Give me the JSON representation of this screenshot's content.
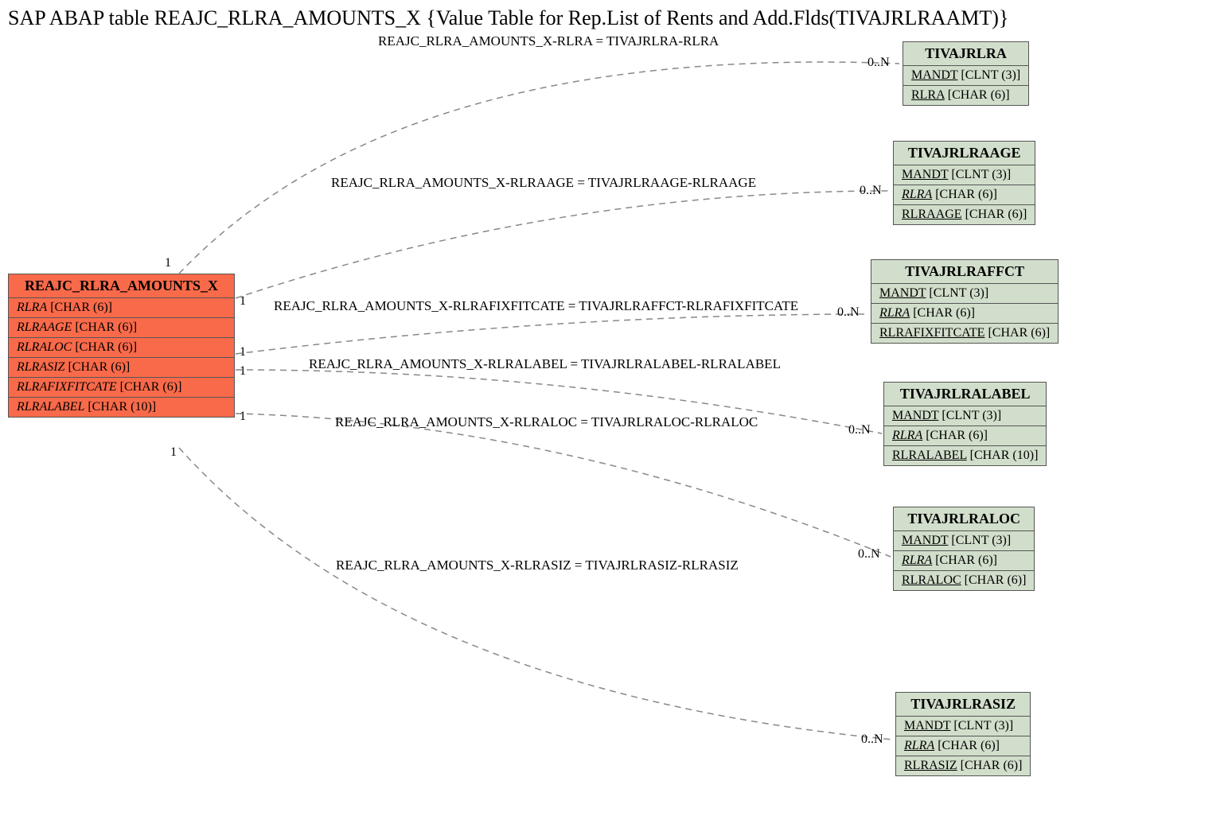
{
  "title": "SAP ABAP table REAJC_RLRA_AMOUNTS_X {Value Table for Rep.List of Rents and Add.Flds(TIVAJRLRAAMT)}",
  "source": {
    "name": "REAJC_RLRA_AMOUNTS_X",
    "fields": [
      {
        "name": "RLRA",
        "type": "[CHAR (6)]"
      },
      {
        "name": "RLRAAGE",
        "type": "[CHAR (6)]"
      },
      {
        "name": "RLRALOC",
        "type": "[CHAR (6)]"
      },
      {
        "name": "RLRASIZ",
        "type": "[CHAR (6)]"
      },
      {
        "name": "RLRAFIXFITCATE",
        "type": "[CHAR (6)]"
      },
      {
        "name": "RLRALABEL",
        "type": "[CHAR (10)]"
      }
    ]
  },
  "targets": [
    {
      "name": "TIVAJRLRA",
      "fields": [
        {
          "name": "MANDT",
          "type": "[CLNT (3)]",
          "underline": true
        },
        {
          "name": "RLRA",
          "type": "[CHAR (6)]",
          "underline": true
        }
      ]
    },
    {
      "name": "TIVAJRLRAAGE",
      "fields": [
        {
          "name": "MANDT",
          "type": "[CLNT (3)]",
          "underline": true
        },
        {
          "name": "RLRA",
          "type": "[CHAR (6)]",
          "underline": true,
          "italic": true
        },
        {
          "name": "RLRAAGE",
          "type": "[CHAR (6)]",
          "underline": true
        }
      ]
    },
    {
      "name": "TIVAJRLRAFFCT",
      "fields": [
        {
          "name": "MANDT",
          "type": "[CLNT (3)]",
          "underline": true
        },
        {
          "name": "RLRA",
          "type": "[CHAR (6)]",
          "underline": true,
          "italic": true
        },
        {
          "name": "RLRAFIXFITCATE",
          "type": "[CHAR (6)]",
          "underline": true
        }
      ]
    },
    {
      "name": "TIVAJRLRALABEL",
      "fields": [
        {
          "name": "MANDT",
          "type": "[CLNT (3)]",
          "underline": true
        },
        {
          "name": "RLRA",
          "type": "[CHAR (6)]",
          "underline": true,
          "italic": true
        },
        {
          "name": "RLRALABEL",
          "type": "[CHAR (10)]",
          "underline": true
        }
      ]
    },
    {
      "name": "TIVAJRLRALOC",
      "fields": [
        {
          "name": "MANDT",
          "type": "[CLNT (3)]",
          "underline": true
        },
        {
          "name": "RLRA",
          "type": "[CHAR (6)]",
          "underline": true,
          "italic": true
        },
        {
          "name": "RLRALOC",
          "type": "[CHAR (6)]",
          "underline": true
        }
      ]
    },
    {
      "name": "TIVAJRLRASIZ",
      "fields": [
        {
          "name": "MANDT",
          "type": "[CLNT (3)]",
          "underline": true
        },
        {
          "name": "RLRA",
          "type": "[CHAR (6)]",
          "underline": true,
          "italic": true
        },
        {
          "name": "RLRASIZ",
          "type": "[CHAR (6)]",
          "underline": true
        }
      ]
    }
  ],
  "relations": [
    {
      "label": "REAJC_RLRA_AMOUNTS_X-RLRA = TIVAJRLRA-RLRA",
      "src_card": "1",
      "tgt_card": "0..N"
    },
    {
      "label": "REAJC_RLRA_AMOUNTS_X-RLRAAGE = TIVAJRLRAAGE-RLRAAGE",
      "src_card": "1",
      "tgt_card": "0..N"
    },
    {
      "label": "REAJC_RLRA_AMOUNTS_X-RLRAFIXFITCATE = TIVAJRLRAFFCT-RLRAFIXFITCATE",
      "src_card": "1",
      "tgt_card": "0..N"
    },
    {
      "label": "REAJC_RLRA_AMOUNTS_X-RLRALABEL = TIVAJRLRALABEL-RLRALABEL",
      "src_card": "1",
      "tgt_card": "0..N"
    },
    {
      "label": "REAJC_RLRA_AMOUNTS_X-RLRALOC = TIVAJRLRALOC-RLRALOC",
      "src_card": "1",
      "tgt_card": "0..N"
    },
    {
      "label": "REAJC_RLRA_AMOUNTS_X-RLRASIZ = TIVAJRLRASIZ-RLRASIZ",
      "src_card": "1",
      "tgt_card": "0..N"
    }
  ]
}
